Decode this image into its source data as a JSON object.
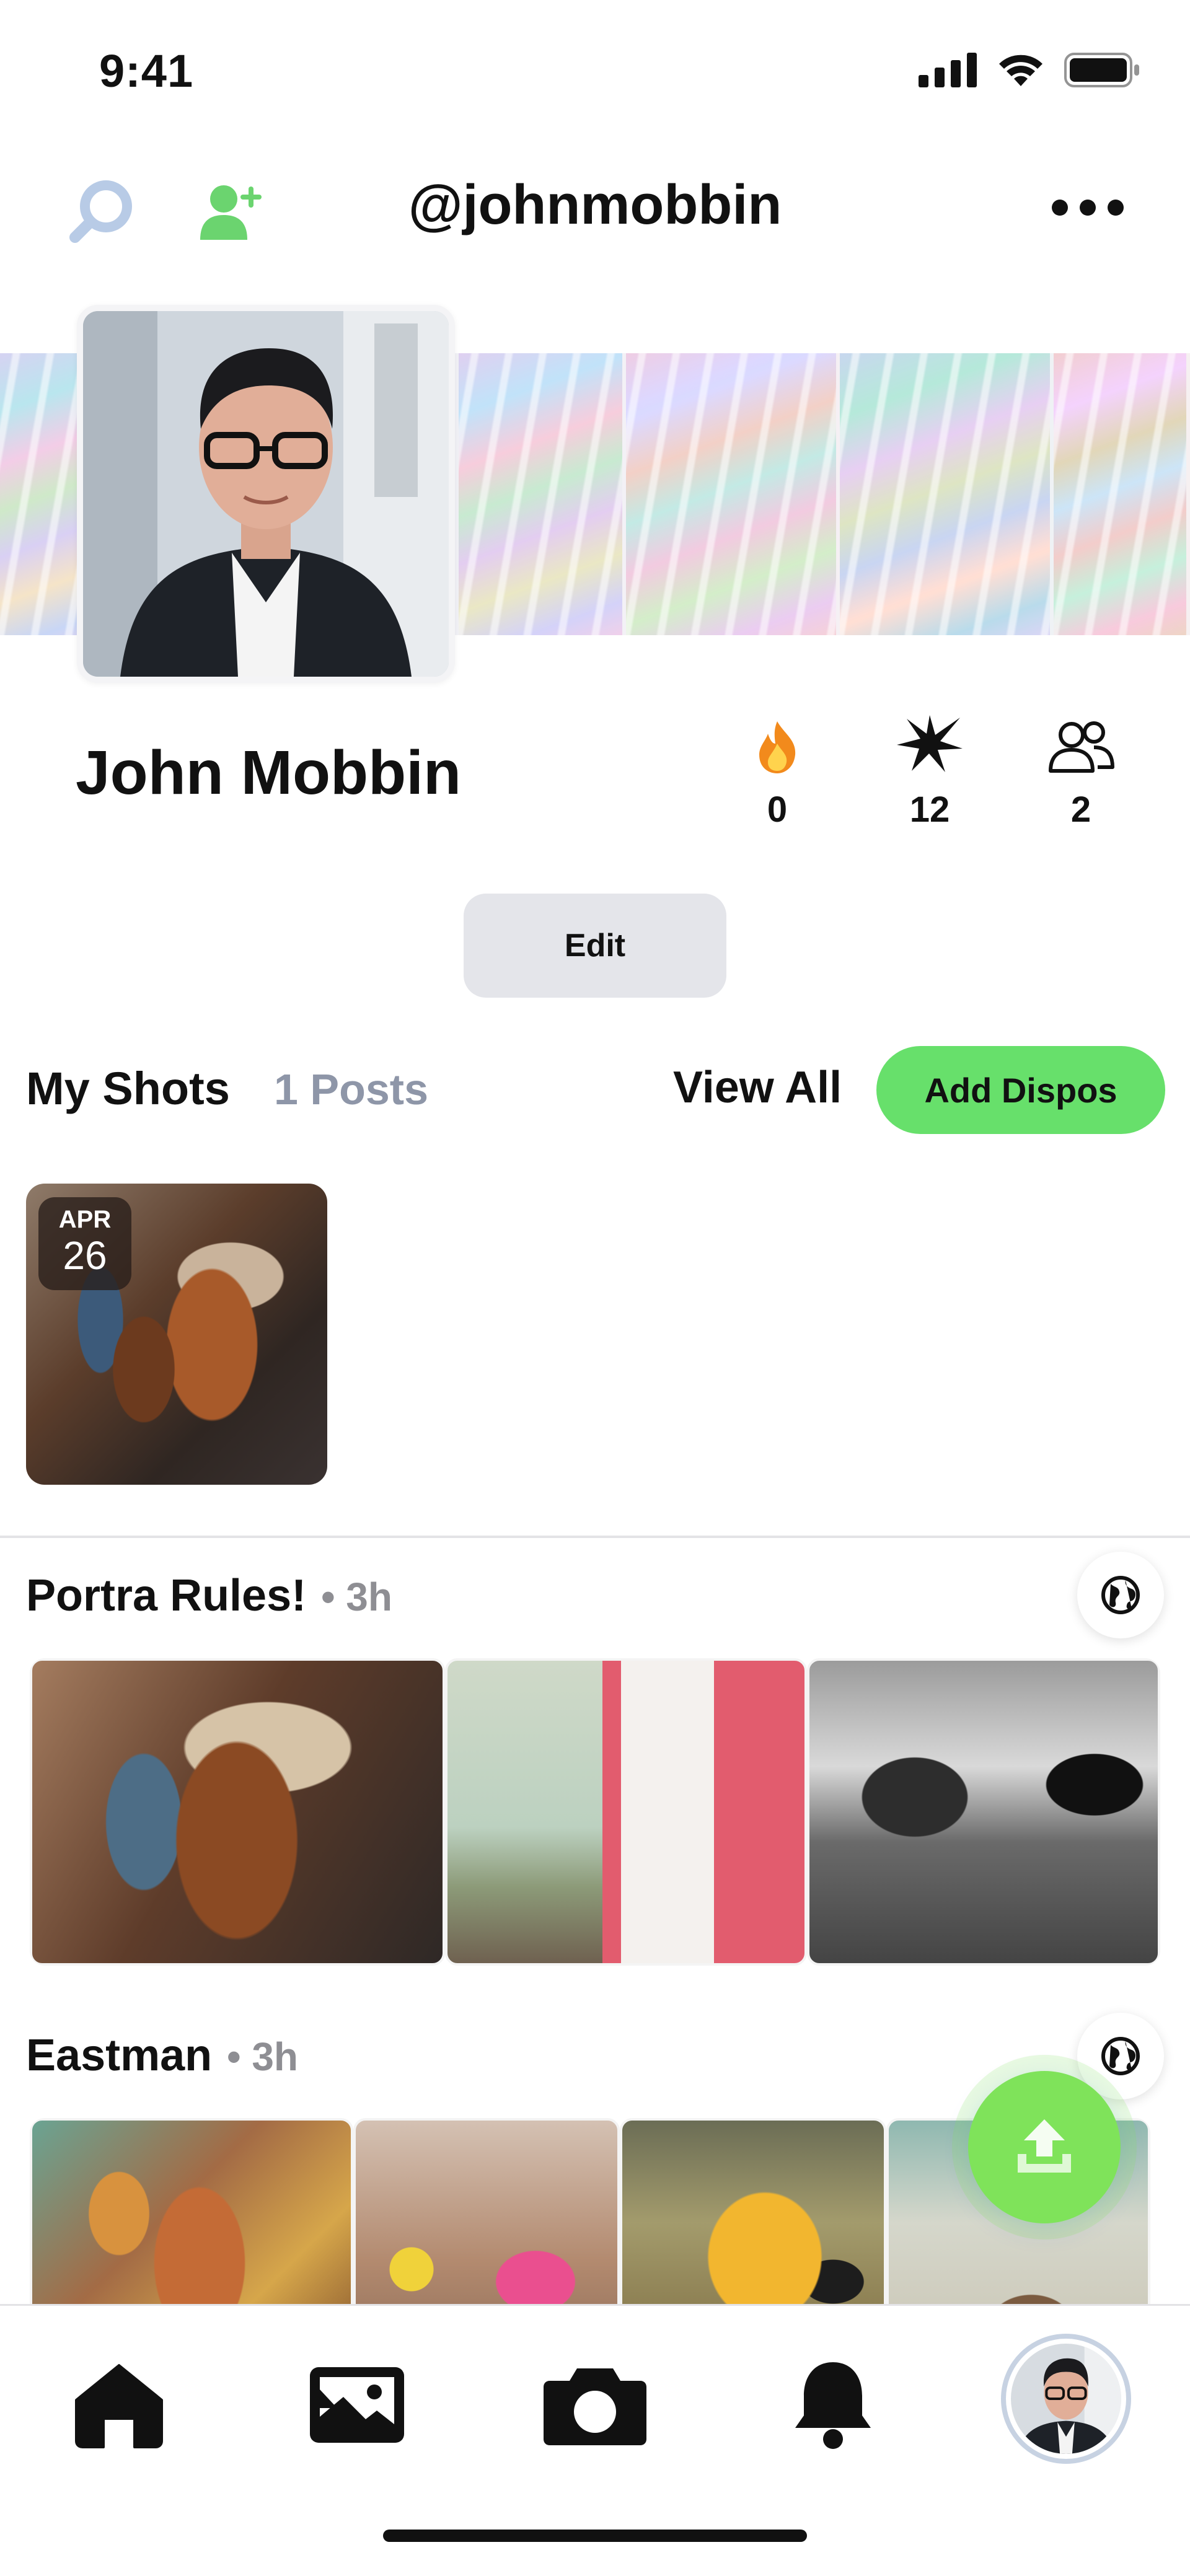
{
  "status_bar": {
    "time": "9:41",
    "icons": [
      "signal-icon",
      "wifi-icon",
      "battery-icon"
    ]
  },
  "header": {
    "username": "@johnmobbin",
    "search_icon": "search-icon",
    "add_friend_icon": "add-person-icon",
    "more_icon": "more-dots-icon"
  },
  "profile": {
    "name": "John Mobbin",
    "stats": [
      {
        "icon": "flame-icon",
        "value": "0"
      },
      {
        "icon": "sparkle-icon",
        "value": "12"
      },
      {
        "icon": "friends-icon",
        "value": "2"
      }
    ],
    "edit_label": "Edit"
  },
  "my_shots": {
    "title": "My Shots",
    "count_label": "1 Posts",
    "view_all": "View All",
    "add_label": "Add Dispos",
    "items": [
      {
        "month": "APR",
        "day": "26"
      }
    ]
  },
  "posts": [
    {
      "title": "Portra Rules!",
      "time": "• 3h",
      "visibility_icon": "globe-icon"
    },
    {
      "title": "Eastman",
      "time": "• 3h",
      "visibility_icon": "globe-icon"
    }
  ],
  "fab": {
    "icon": "upload-icon"
  },
  "tab_bar": {
    "items": [
      "home-icon",
      "gallery-icon",
      "camera-icon",
      "bell-icon",
      "profile-avatar"
    ]
  },
  "colors": {
    "accent_green": "#67e06b",
    "fab_green": "#7fe35a",
    "add_friend_green": "#6bd46f",
    "search_blue": "#b8cbe6",
    "muted_gray": "#8e96a8"
  }
}
